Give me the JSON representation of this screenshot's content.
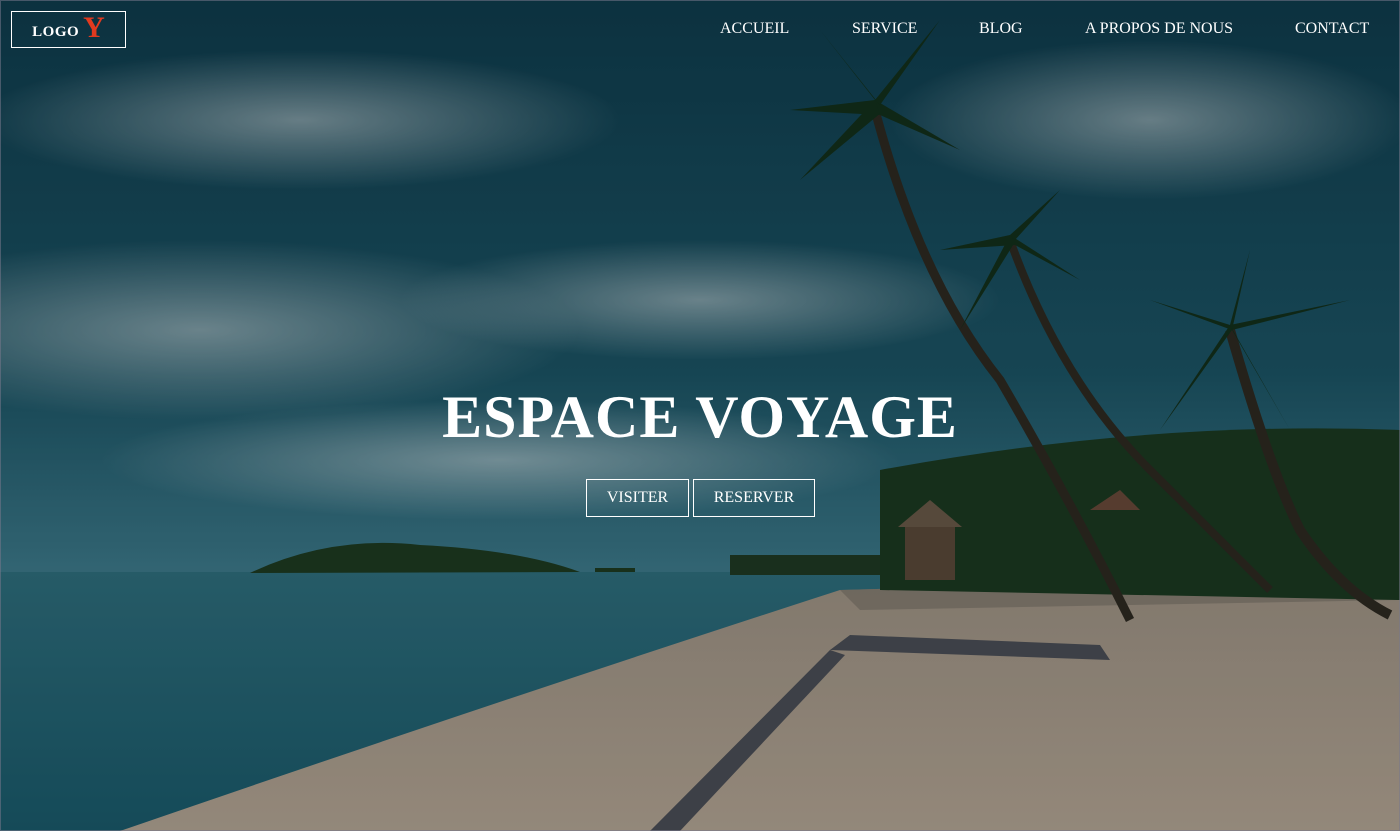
{
  "brand": {
    "logo_text": "LOGO",
    "logo_accent": "Y",
    "accent_color": "#e23a1f"
  },
  "nav": {
    "items": [
      {
        "label": "ACCUEIL"
      },
      {
        "label": "SERVICE"
      },
      {
        "label": "BLOG"
      },
      {
        "label": "A PROPOS DE NOUS"
      },
      {
        "label": "CONTACT"
      }
    ]
  },
  "hero": {
    "title": "ESPACE VOYAGE",
    "buttons": {
      "visit_label": "VISITER",
      "book_label": "RESERVER"
    }
  }
}
